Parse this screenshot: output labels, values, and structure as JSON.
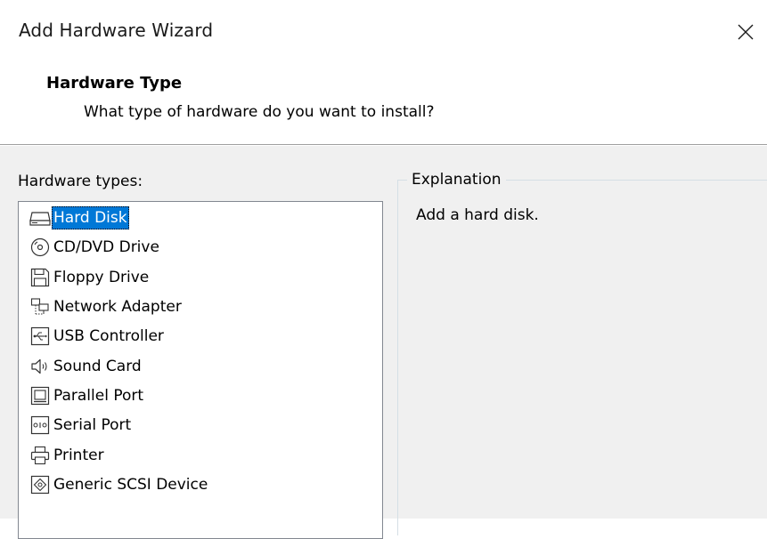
{
  "window": {
    "title": "Add Hardware Wizard",
    "close_label": "×"
  },
  "header": {
    "title": "Hardware Type",
    "subtitle": "What type of hardware do you want to install?"
  },
  "hardware_types": {
    "label": "Hardware types:",
    "selected_index": 0,
    "items": [
      {
        "label": "Hard Disk",
        "icon": "hard-disk-icon"
      },
      {
        "label": "CD/DVD Drive",
        "icon": "cd-dvd-icon"
      },
      {
        "label": "Floppy Drive",
        "icon": "floppy-icon"
      },
      {
        "label": "Network Adapter",
        "icon": "network-adapter-icon"
      },
      {
        "label": "USB Controller",
        "icon": "usb-icon"
      },
      {
        "label": "Sound Card",
        "icon": "sound-card-icon"
      },
      {
        "label": "Parallel Port",
        "icon": "parallel-port-icon"
      },
      {
        "label": "Serial Port",
        "icon": "serial-port-icon"
      },
      {
        "label": "Printer",
        "icon": "printer-icon"
      },
      {
        "label": "Generic SCSI Device",
        "icon": "scsi-device-icon"
      }
    ]
  },
  "explanation": {
    "legend": "Explanation",
    "text": "Add a hard disk."
  },
  "colors": {
    "selection": "#0078d7",
    "panel_background": "#f0f0f0"
  }
}
